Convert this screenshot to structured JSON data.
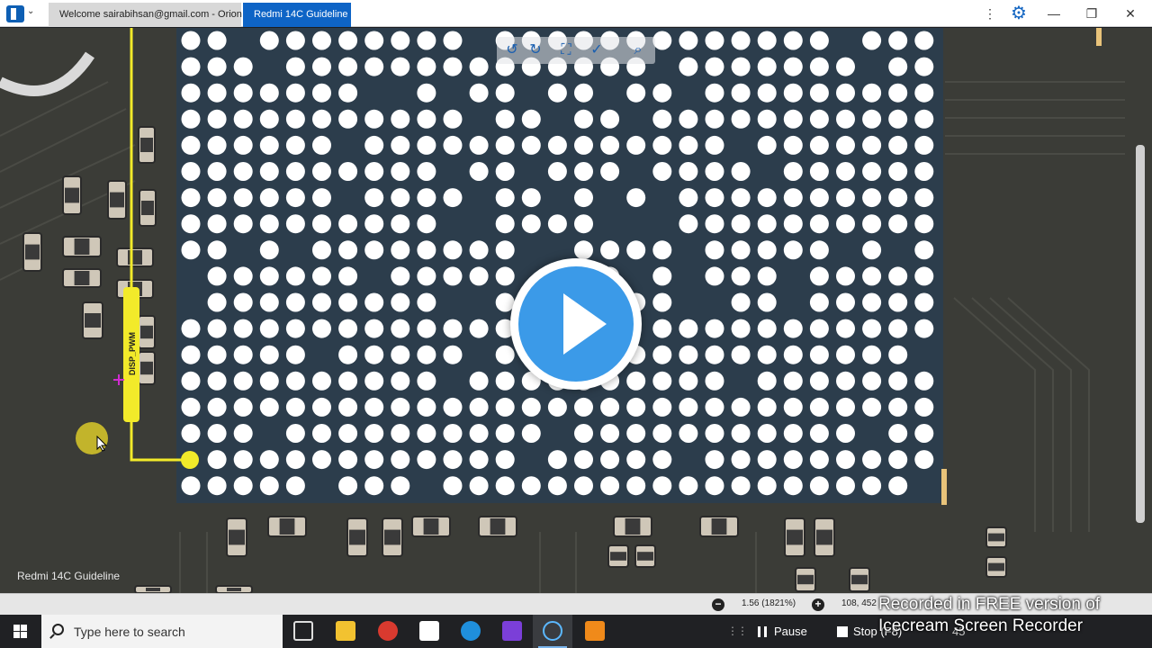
{
  "window": {
    "tabs": [
      {
        "label": "Welcome sairabihsan@gmail.com - Orion"
      },
      {
        "label": "Redmi 14C Guideline"
      }
    ],
    "buttons": {
      "more": "⋮",
      "settings": "⚙",
      "minimize": "—",
      "maximize": "❐",
      "close": "✕"
    }
  },
  "board": {
    "net_label": "DISP_PWM",
    "bottom_label": "Redmi 14C Guideline",
    "toolbar_icons": [
      "rotate-left-icon",
      "rotate-right-icon",
      "fit-screen-icon",
      "pen-tool-icon",
      "search-icon"
    ],
    "colors": {
      "net_highlight": "#f2ea2a",
      "pads": "#ffffff",
      "ic_body": "#2c3d4c",
      "pcb": "#3b3c37"
    }
  },
  "statusbar": {
    "zoom": "1.56 (1821%)",
    "coords": "108, 452"
  },
  "recorder_watermark": {
    "line1": "Recorded in FREE version of",
    "line2": "Icecream  Screen  Recorder"
  },
  "taskbar": {
    "search_placeholder": "Type here to search",
    "pause_label": "Pause",
    "stop_label": "Stop (F8)",
    "counter": "45"
  }
}
